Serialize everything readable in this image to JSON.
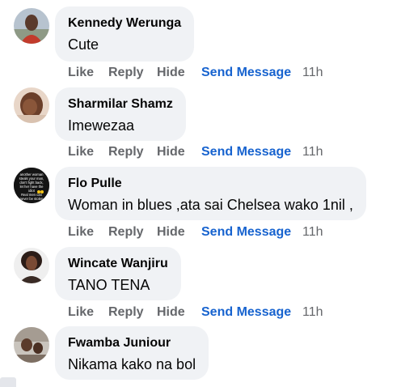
{
  "comments": [
    {
      "author": "Kennedy Werunga",
      "text": "Cute",
      "time": "11h"
    },
    {
      "author": "Sharmilar Shamz",
      "text": "Imewezaa",
      "time": "11h"
    },
    {
      "author": "Flo Pulle",
      "text": "Woman in blues ,ata sai Chelsea wako 1nil ,",
      "time": "11h",
      "avatar_text": "another woman steals your man, don't fight back, let her have the idiot Real men can never be stolen"
    },
    {
      "author": "Wincate Wanjiru",
      "text": "TANO TENA",
      "time": "11h"
    },
    {
      "author": "Fwamba Juniour",
      "text": "Nikama kako na bol",
      "time": ""
    }
  ],
  "actions": {
    "like": "Like",
    "reply": "Reply",
    "hide": "Hide",
    "send_message": "Send Message"
  },
  "colors": {
    "bubble": "#f0f2f5",
    "action_gray": "#65676b",
    "send_blue": "#1763cf",
    "text": "#050505"
  }
}
